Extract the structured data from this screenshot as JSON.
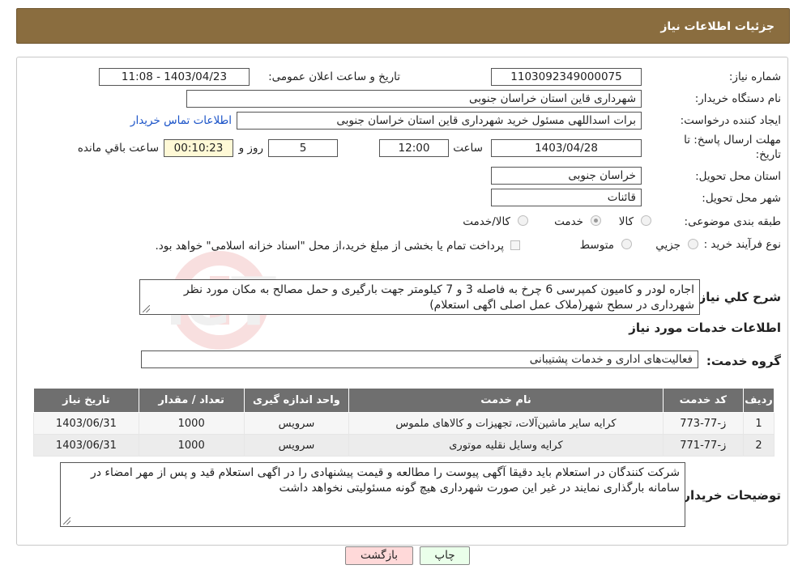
{
  "header": {
    "title": "جزئیات اطلاعات نیاز"
  },
  "form": {
    "need_number_label": "شماره نیاز:",
    "need_number": "1103092349000075",
    "announce_label": "تاریخ و ساعت اعلان عمومی:",
    "announce_value": "1403/04/23 - 11:08",
    "buyer_org_label": "نام دستگاه خریدار:",
    "buyer_org": "شهرداری قاین استان خراسان جنوبی",
    "requester_label": "ایجاد کننده درخواست:",
    "requester": "برات اسداللهی مسئول خرید شهرداری قاین استان خراسان جنوبی",
    "contact_link": "اطلاعات تماس خریدار",
    "deadline_label_1": "مهلت ارسال پاسخ: تا",
    "deadline_label_2": "تاریخ:",
    "deadline_date": "1403/04/28",
    "time_label": "ساعت",
    "deadline_time": "12:00",
    "days_value": "5",
    "days_label": "روز و",
    "remaining_time": "00:10:23",
    "remaining_label": "ساعت باقي مانده",
    "delivery_province_label": "استان محل تحویل:",
    "delivery_province": "خراسان جنوبی",
    "delivery_city_label": "شهر محل تحویل:",
    "delivery_city": "قائنات",
    "category_label": "طبقه بندی موضوعی:",
    "category_options": [
      "کالا",
      "خدمت",
      "کالا/خدمت"
    ],
    "category_selected": "خدمت",
    "process_label": "نوع فرآیند خرید :",
    "process_options": [
      "جزیي",
      "متوسط"
    ],
    "treasury_text": "پرداخت تمام یا بخشی از مبلغ خرید،از محل \"اسناد خزانه اسلامی\" خواهد بود."
  },
  "description": {
    "label": "شرح کلي نياز:",
    "text": "اجاره لودر و کامیون کمپرسی 6 چرخ به فاصله 3 و 7 کیلومتر جهت بارگیری و حمل مصالح به مکان مورد نظر شهرداری در سطح شهر(ملاک عمل اصلی اگهی استعلام)"
  },
  "services": {
    "section_title": "اطلاعات خدمات مورد نياز",
    "group_label": "گروه خدمت:",
    "group_value": "فعالیت‌های اداری و خدمات پشتیبانی",
    "columns": [
      "ردیف",
      "کد خدمت",
      "نام خدمت",
      "واحد اندازه گیری",
      "تعداد / مقدار",
      "تاریخ نیاز"
    ],
    "rows": [
      {
        "idx": "1",
        "code": "ز-77-773",
        "name": "کرایه سایر ماشین‌آلات، تجهیزات و کالاهای ملموس",
        "unit": "سرویس",
        "qty": "1000",
        "date": "1403/06/31"
      },
      {
        "idx": "2",
        "code": "ز-77-771",
        "name": "کرایه وسایل نقلیه موتوری",
        "unit": "سرویس",
        "qty": "1000",
        "date": "1403/06/31"
      }
    ]
  },
  "buyer_notes": {
    "label": "توضیحات خریدار:",
    "text": "شرکت کنندگان در استعلام باید دقیقا آگهی پیوست را مطالعه و قیمت پیشنهادی را در اگهی استعلام قید و پس از مهر امضاء در سامانه بارگذاری نمایند در غیر این صورت شهرداری هیچ گونه مسئولیتی نخواهد داشت"
  },
  "buttons": {
    "print": "چاپ",
    "back": "بازگشت"
  },
  "watermark_text": "AriaTender.neT",
  "colors": {
    "header": "#8a6d3f",
    "table_header": "#6f6f6f",
    "timer_bg": "#fff9d6",
    "link": "#1a53c8",
    "back_btn": "#ffd9d9",
    "print_btn": "#eaffea"
  }
}
